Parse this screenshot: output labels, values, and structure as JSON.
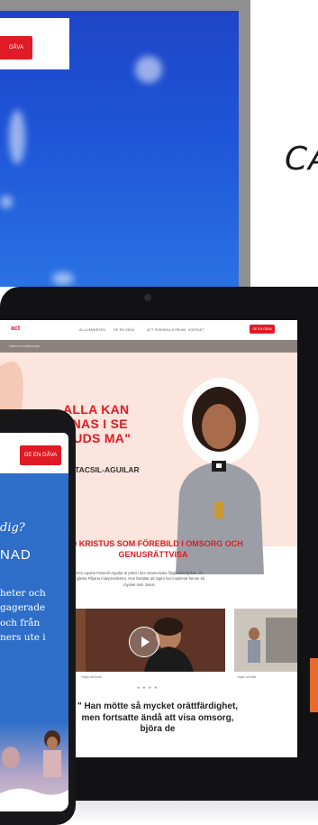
{
  "monitor": {
    "cta_label": "GÅVA"
  },
  "handwriting": "CA",
  "tablet": {
    "logo": "act",
    "nav_links": [
      "ALLA ÄMNESEN",
      "GE EN GÅVA",
      "ACT SVENSKA KYRKAN",
      "KONTAKT"
    ],
    "cta_label": "GE EN GÅVA",
    "breadcrumb": "FÖRSTA & STÄRKANDE",
    "hero_title": "ALLA KAN ENAS I SE GUDS MA\"",
    "hero_name": "D PATACSIL-AGUILAR",
    "hero_role": "nema",
    "section_title": "IED KRISTUS SOM FÖREBILD I OMSORG OCH GENUSRÄTTVISA",
    "section_body": "leen Aquino Patacsil-Aguilar är präst i den ekumeniska filippinska kyrkan. IFI (Iglesia Filipina Independiente). Hon berättar att ingen har inspirerat henne så mycket som Jesus.",
    "caption_1": "Vägen att förstå",
    "caption_2": "Vägen att hålla",
    "dots": "● ● ● ●",
    "quote": "\" Han mötte så mycket orättfärdighet, men fortsatte ändå att visa omsorg, björa de"
  },
  "phone": {
    "cta_label": "GE EN GÅVA",
    "question": "dig?",
    "heading": "NAD",
    "body_lines": [
      "heter och",
      "gagerade",
      "och från",
      "ners ute i"
    ]
  },
  "colors": {
    "brand_red": "#e01b25",
    "hero_peach": "#fbe5dc",
    "sky_blue": "#2e6ec9"
  }
}
